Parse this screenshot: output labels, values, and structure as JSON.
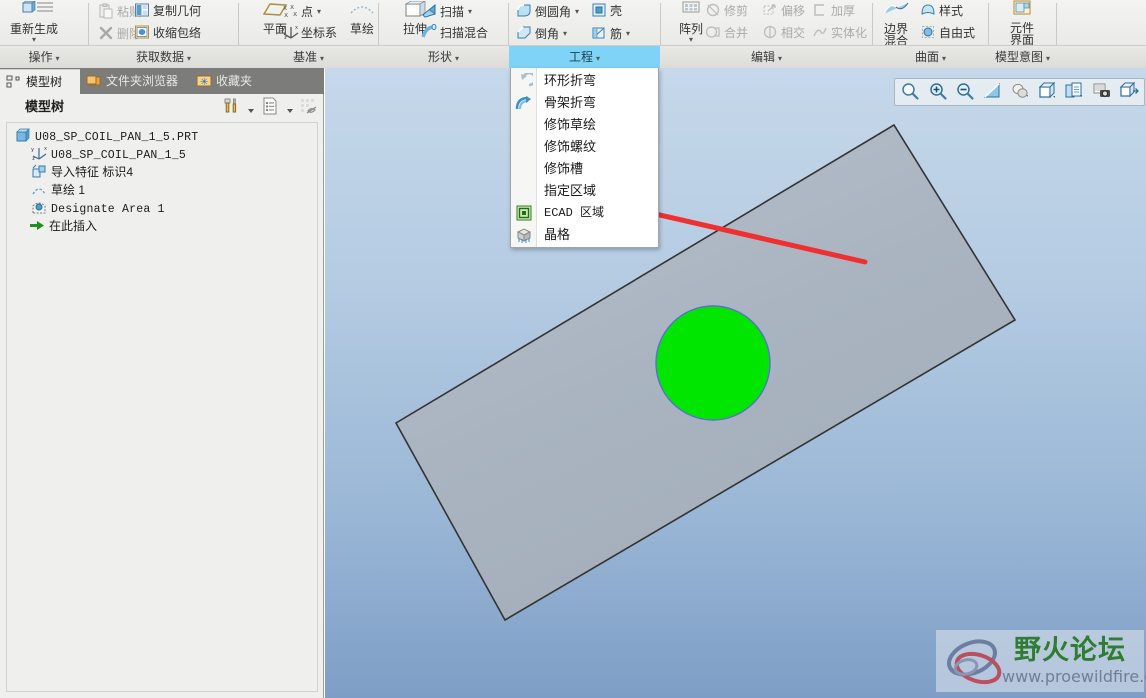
{
  "ribbon": {
    "groups": [
      {
        "label": "操作",
        "buttons_large": [
          {
            "name": "regenerate",
            "label": "重新生成",
            "icon": "regenerate-icon",
            "has_caret": true
          }
        ],
        "buttons_small": [
          {
            "name": "paste",
            "label": "粘贴",
            "icon": "paste-icon",
            "caret": true,
            "disabled": true
          },
          {
            "name": "delete",
            "label": "删除",
            "icon": "delete-icon",
            "caret": true,
            "disabled": true
          }
        ]
      },
      {
        "label": "获取数据",
        "buttons_small": [
          {
            "name": "copy-geometry",
            "label": "复制几何",
            "icon": "copy-geometry-icon",
            "caret": false,
            "disabled": false
          },
          {
            "name": "shrinkwrap",
            "label": "收缩包络",
            "icon": "shrinkwrap-icon",
            "caret": false,
            "disabled": false
          }
        ]
      },
      {
        "label": "基准",
        "buttons_large": [
          {
            "name": "plane",
            "label": "平面",
            "icon": "datum-plane-icon",
            "has_caret": false
          }
        ],
        "buttons_small": [
          {
            "name": "point",
            "label": "点",
            "icon": "datum-point-icon",
            "caret": true,
            "disabled": false
          },
          {
            "name": "coordinate-system",
            "label": "坐标系",
            "icon": "csys-icon",
            "caret": false,
            "disabled": false
          }
        ]
      },
      {
        "label": "形状",
        "buttons_large_extra": [
          {
            "name": "sketch",
            "label": "草绘",
            "icon": "sketch-icon"
          }
        ],
        "buttons_large": [
          {
            "name": "extrude",
            "label": "拉伸",
            "icon": "extrude-icon",
            "has_caret": false
          }
        ],
        "buttons_small": [
          {
            "name": "sweep",
            "label": "扫描",
            "icon": "sweep-icon",
            "caret": true,
            "disabled": false
          },
          {
            "name": "swept-blend",
            "label": "扫描混合",
            "icon": "swept-blend-icon",
            "caret": false,
            "disabled": false
          }
        ]
      },
      {
        "label": "工程",
        "active": true,
        "buttons_small": [
          {
            "name": "round",
            "label": "倒圆角",
            "icon": "round-icon",
            "caret": true,
            "disabled": false
          },
          {
            "name": "shell",
            "label": "壳",
            "icon": "shell-icon",
            "caret": false,
            "disabled": false
          },
          {
            "name": "chamfer",
            "label": "倒角",
            "icon": "chamfer-icon",
            "caret": true,
            "disabled": false
          },
          {
            "name": "rib",
            "label": "筋",
            "icon": "rib-icon",
            "caret": true,
            "disabled": false
          }
        ]
      },
      {
        "label": "编辑",
        "buttons_large": [
          {
            "name": "pattern",
            "label": "阵列",
            "icon": "pattern-icon",
            "has_caret": true
          }
        ],
        "buttons_small": [
          {
            "name": "trim",
            "label": "修剪",
            "icon": "trim-icon",
            "caret": false,
            "disabled": true
          },
          {
            "name": "offset",
            "label": "偏移",
            "icon": "offset-icon",
            "caret": false,
            "disabled": true
          },
          {
            "name": "thicken",
            "label": "加厚",
            "icon": "thicken-icon",
            "caret": false,
            "disabled": true
          },
          {
            "name": "merge",
            "label": "合并",
            "icon": "merge-icon",
            "caret": false,
            "disabled": true
          },
          {
            "name": "intersect",
            "label": "相交",
            "icon": "intersect-icon",
            "caret": false,
            "disabled": true
          },
          {
            "name": "solidify",
            "label": "实体化",
            "icon": "solidify-icon",
            "caret": false,
            "disabled": true
          }
        ]
      },
      {
        "label": "曲面",
        "buttons_large": [
          {
            "name": "boundary-blend",
            "label": "边界混合",
            "icon": "boundary-blend-icon",
            "has_caret": false
          }
        ],
        "buttons_small": [
          {
            "name": "style",
            "label": "样式",
            "icon": "style-icon",
            "caret": false,
            "disabled": false
          },
          {
            "name": "freestyle",
            "label": "自由式",
            "icon": "freestyle-icon",
            "caret": false,
            "disabled": false
          }
        ]
      },
      {
        "label": "模型意图",
        "buttons_large": [
          {
            "name": "component-interface",
            "label": "元件界面",
            "icon": "component-interface-icon",
            "has_caret": false
          }
        ]
      }
    ]
  },
  "menu": {
    "name": "engineering-dropdown-menu",
    "items": [
      {
        "label": "环形折弯",
        "icon": "toroidal-bend-icon",
        "has_icon": true,
        "mono": false
      },
      {
        "label": "骨架折弯",
        "icon": "spinal-bend-icon",
        "has_icon": true,
        "mono": false
      },
      {
        "label": "修饰草绘",
        "icon": "",
        "has_icon": false,
        "mono": false
      },
      {
        "label": "修饰螺纹",
        "icon": "",
        "has_icon": false,
        "mono": false
      },
      {
        "label": "修饰槽",
        "icon": "",
        "has_icon": false,
        "mono": false
      },
      {
        "label": "指定区域",
        "icon": "",
        "has_icon": false,
        "mono": false
      },
      {
        "label": "ECAD 区域",
        "icon": "ecad-area-icon",
        "has_icon": true,
        "mono": true
      },
      {
        "label": "晶格",
        "icon": "lattice-icon",
        "has_icon": true,
        "mono": false
      }
    ]
  },
  "left_panel": {
    "tabs": [
      {
        "label": "模型树",
        "icon": "model-tree-icon",
        "active": true
      },
      {
        "label": "文件夹浏览器",
        "icon": "folder-browser-icon",
        "active": false
      },
      {
        "label": "收藏夹",
        "icon": "favorites-icon",
        "active": false
      }
    ],
    "title": "模型树",
    "tools": [
      {
        "name": "settings-tools-icon"
      },
      {
        "name": "tools-caret-icon"
      },
      {
        "name": "display-list-icon"
      },
      {
        "name": "display-caret-icon"
      },
      {
        "name": "filter-icon"
      }
    ],
    "tree": [
      {
        "label": "U08_SP_COIL_PAN_1_5.PRT",
        "icon": "part-icon",
        "indent": 0,
        "mono": true
      },
      {
        "label": "U08_SP_COIL_PAN_1_5",
        "icon": "csys-icon",
        "indent": 1,
        "mono": true
      },
      {
        "label": "导入特征 标识4",
        "icon": "import-feature-icon",
        "indent": 1,
        "mono": false
      },
      {
        "label": "草绘 1",
        "icon": "sketch-feature-icon",
        "indent": 1,
        "mono": false
      },
      {
        "label": "Designate Area 1",
        "icon": "designate-area-icon",
        "indent": 1,
        "mono": true
      },
      {
        "label": "在此插入",
        "icon": "insert-here-icon",
        "indent": 1,
        "mono": false
      }
    ]
  },
  "graphics": {
    "toolbar": [
      {
        "name": "zoom-region-icon"
      },
      {
        "name": "zoom-in-icon"
      },
      {
        "name": "zoom-out-icon"
      },
      {
        "name": "refit-icon"
      },
      {
        "name": "display-shading-icon"
      },
      {
        "name": "display-style-icon"
      },
      {
        "name": "appearance-icon"
      },
      {
        "name": "saved-views-icon"
      },
      {
        "name": "view-manager-icon"
      }
    ],
    "model": {
      "plate_color": "#aab4bf",
      "plate_edge_color": "#333333",
      "circle_fill": "#00e600",
      "circle_edge": "#5a6fd0",
      "arrow_color": "#f03030"
    },
    "watermark": {
      "title": "野火论坛",
      "url": "www.proewildfire.cn"
    }
  },
  "colors": {
    "ribbon_active": "#7ed3f7",
    "panel_bg": "#efefed",
    "tabbar_bg": "#7c7c7a",
    "bg_top": "#c6d8ea",
    "bg_bottom": "#7e9ec6"
  }
}
